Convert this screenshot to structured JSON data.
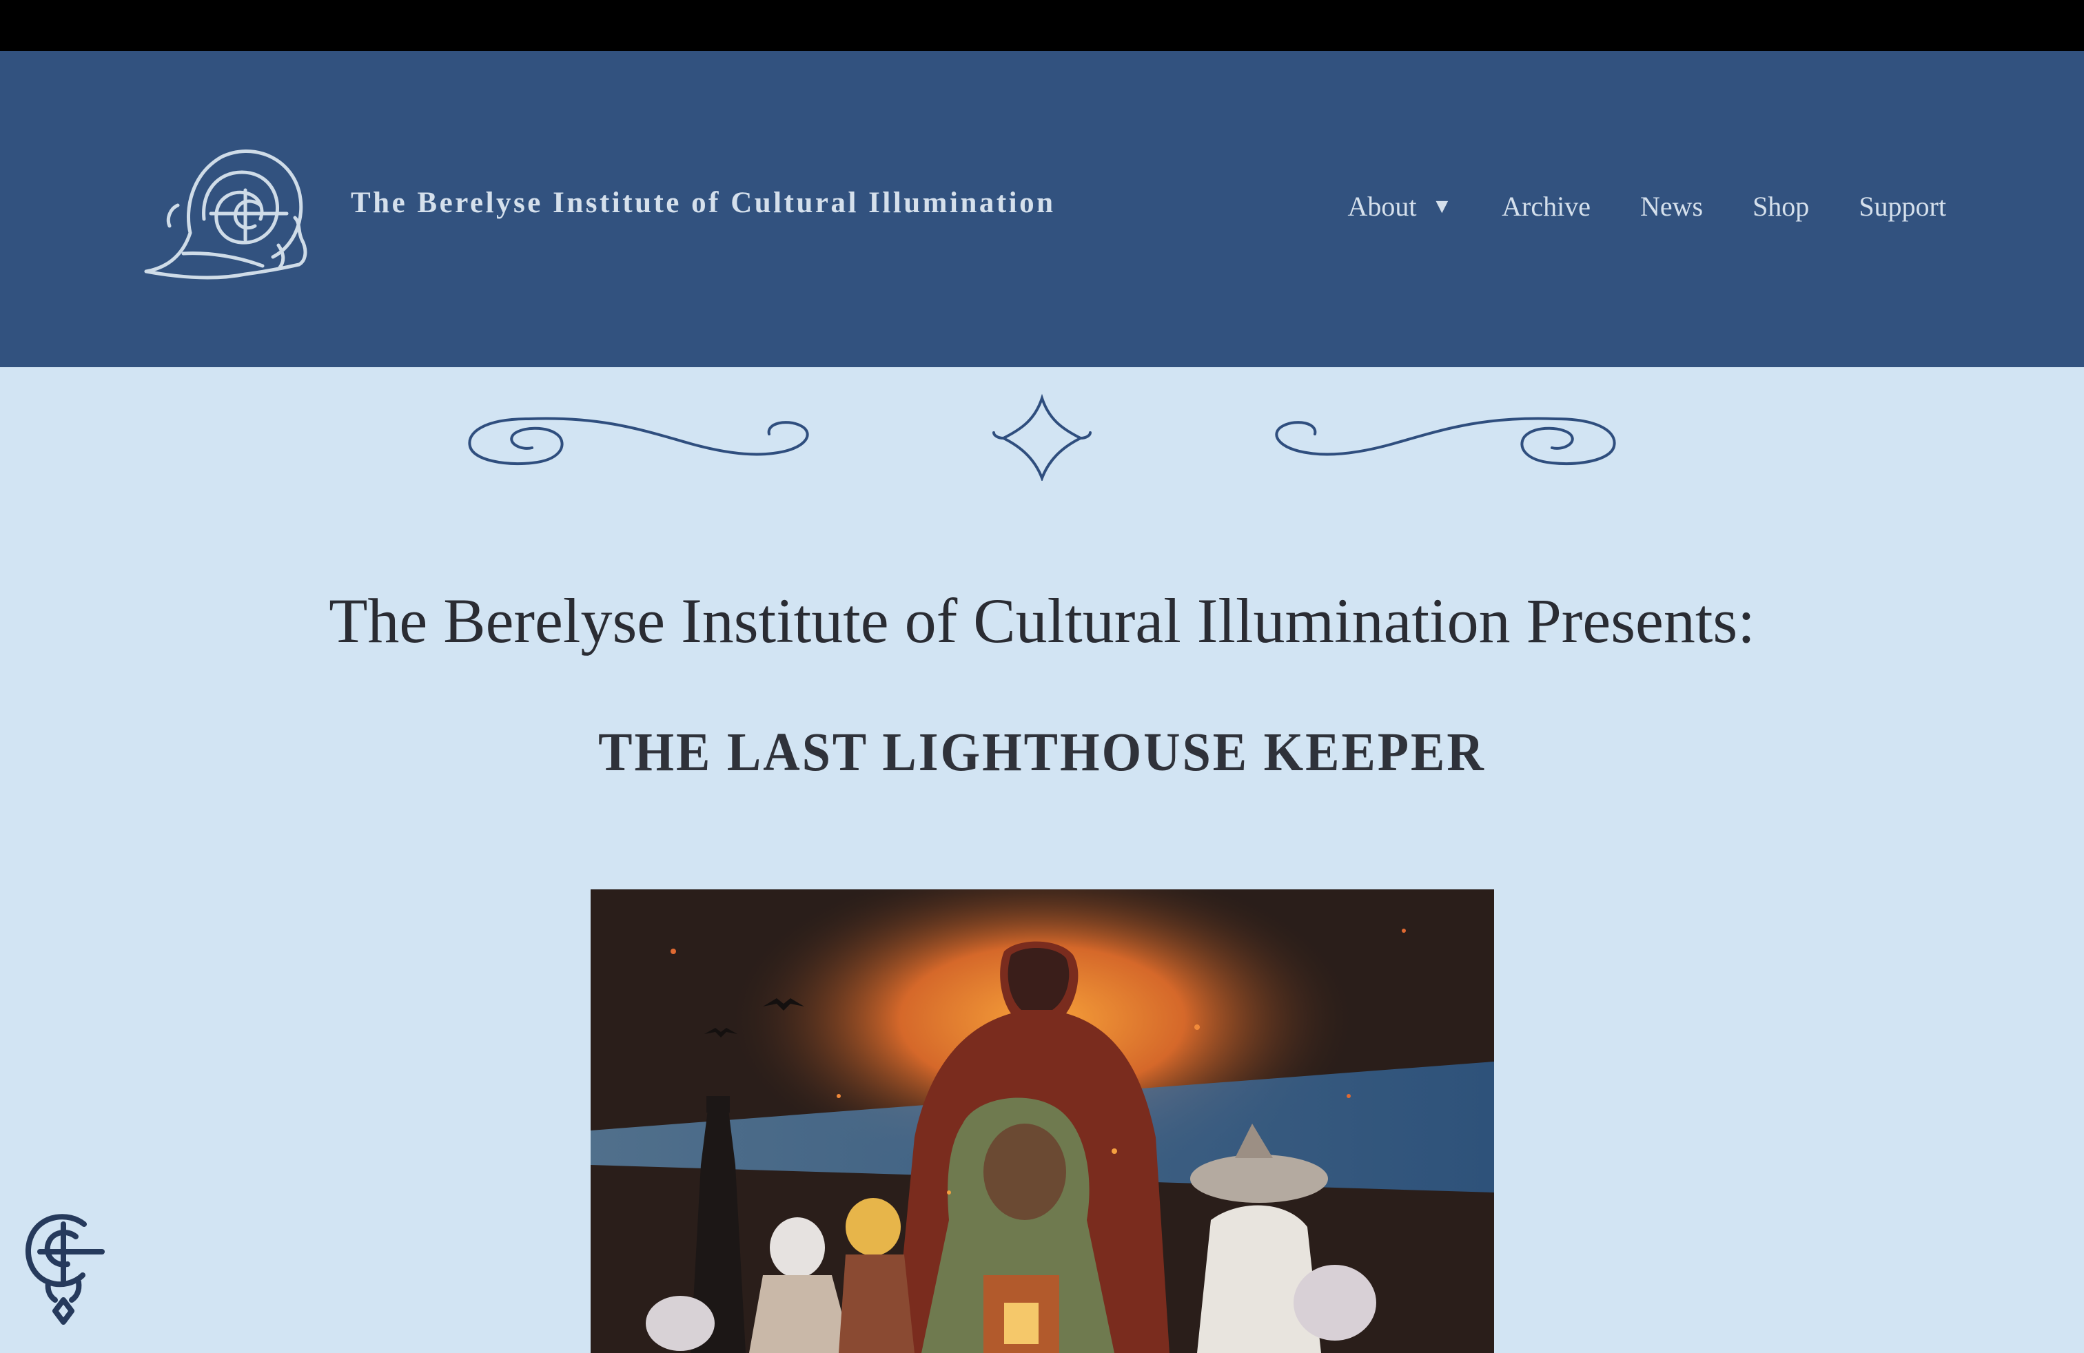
{
  "header": {
    "site_title": "The Berelyse Institute of Cultural Illumination",
    "logo_icon": "snail-shell-logo-icon",
    "nav": [
      {
        "label": "About",
        "has_dropdown": true
      },
      {
        "label": "Archive"
      },
      {
        "label": "News"
      },
      {
        "label": "Shop"
      },
      {
        "label": "Support"
      }
    ],
    "dropdown_caret": "▼"
  },
  "main": {
    "presents_heading": "The Berelyse Institute of Cultural Illumination Presents:",
    "book_title": "THE LAST LIGHTHOUSE KEEPER",
    "cover_image": "book-cover-illustration"
  },
  "colors": {
    "top_bar": "#000000",
    "header_bg": "#32527f",
    "page_bg": "#d2e4f3",
    "header_text": "#d5e0ec",
    "flourish": "#2f4e7e",
    "heading_text": "#2a2c33"
  },
  "floating_badge": {
    "icon": "institute-monogram-icon"
  }
}
